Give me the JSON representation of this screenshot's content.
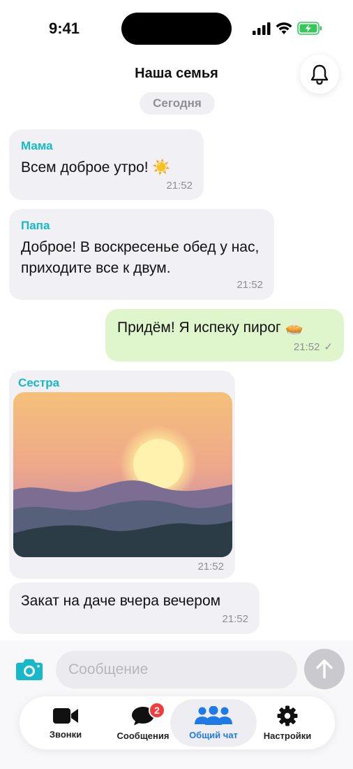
{
  "status_bar": {
    "time": "9:41"
  },
  "header": {
    "title": "Наша семья",
    "date_separator": "Сегодня"
  },
  "messages": [
    {
      "sender": "Мама",
      "text": "Всем доброе утро! ☀️",
      "time": "21:52"
    },
    {
      "sender": "Папа",
      "text": "Доброе! В воскресенье обед у нас, приходите все к двум.",
      "time": "21:52"
    },
    {
      "text": "Придём! Я испеку пирог 🥧",
      "time": "21:52",
      "status_icon": "checkmark-icon"
    },
    {
      "sender": "Сестра",
      "image": "sunset-photo",
      "time": "21:52"
    },
    {
      "text": "Закат на даче вчера вечером",
      "time": "21:52"
    }
  ],
  "composer": {
    "placeholder": "Сообщение"
  },
  "tabs": [
    {
      "label": "Звонки",
      "icon": "video-camera-icon"
    },
    {
      "label": "Сообщения",
      "icon": "chat-bubble-icon",
      "badge": "2"
    },
    {
      "label": "Общий чат",
      "icon": "group-icon",
      "active": true
    },
    {
      "label": "Настройки",
      "icon": "gear-icon"
    }
  ],
  "colors": {
    "accent": "#1e7be6",
    "sender": "#17b9c9",
    "outgoing": "#dff6cd",
    "badge": "#f53b3b"
  }
}
